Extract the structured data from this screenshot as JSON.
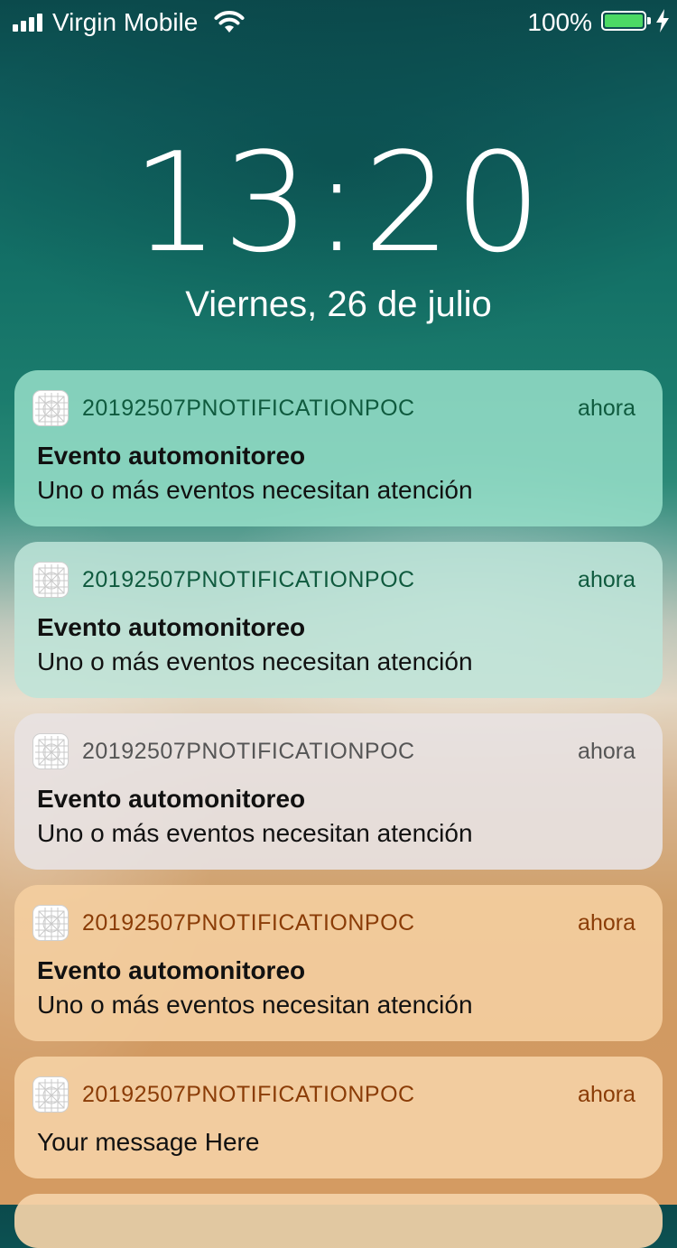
{
  "status_bar": {
    "carrier": "Virgin Mobile",
    "battery_percent": "100%",
    "battery_level": 1.0,
    "icons": [
      "signal-icon",
      "wifi-icon",
      "battery-icon",
      "charging-icon"
    ]
  },
  "lock_screen": {
    "time": "13:20",
    "date": "Viernes, 26 de julio"
  },
  "notifications": [
    {
      "app_name": "20192507PNOTIFICATIONPOC",
      "time": "ahora",
      "title": "Evento automonitoreo",
      "body": "Uno o más eventos necesitan atención"
    },
    {
      "app_name": "20192507PNOTIFICATIONPOC",
      "time": "ahora",
      "title": "Evento automonitoreo",
      "body": "Uno o más eventos necesitan atención"
    },
    {
      "app_name": "20192507PNOTIFICATIONPOC",
      "time": "ahora",
      "title": "Evento automonitoreo",
      "body": "Uno o más eventos necesitan atención"
    },
    {
      "app_name": "20192507PNOTIFICATIONPOC",
      "time": "ahora",
      "title": "Evento automonitoreo",
      "body": "Uno o más eventos necesitan atención"
    },
    {
      "app_name": "20192507PNOTIFICATIONPOC",
      "time": "ahora",
      "body": "Your message Here"
    }
  ],
  "colors": {
    "battery_fill": "#4cd964",
    "notification_text_teal": "#0f5a3e",
    "notification_text_gray": "#555555",
    "notification_text_orange": "#8a3c07"
  }
}
